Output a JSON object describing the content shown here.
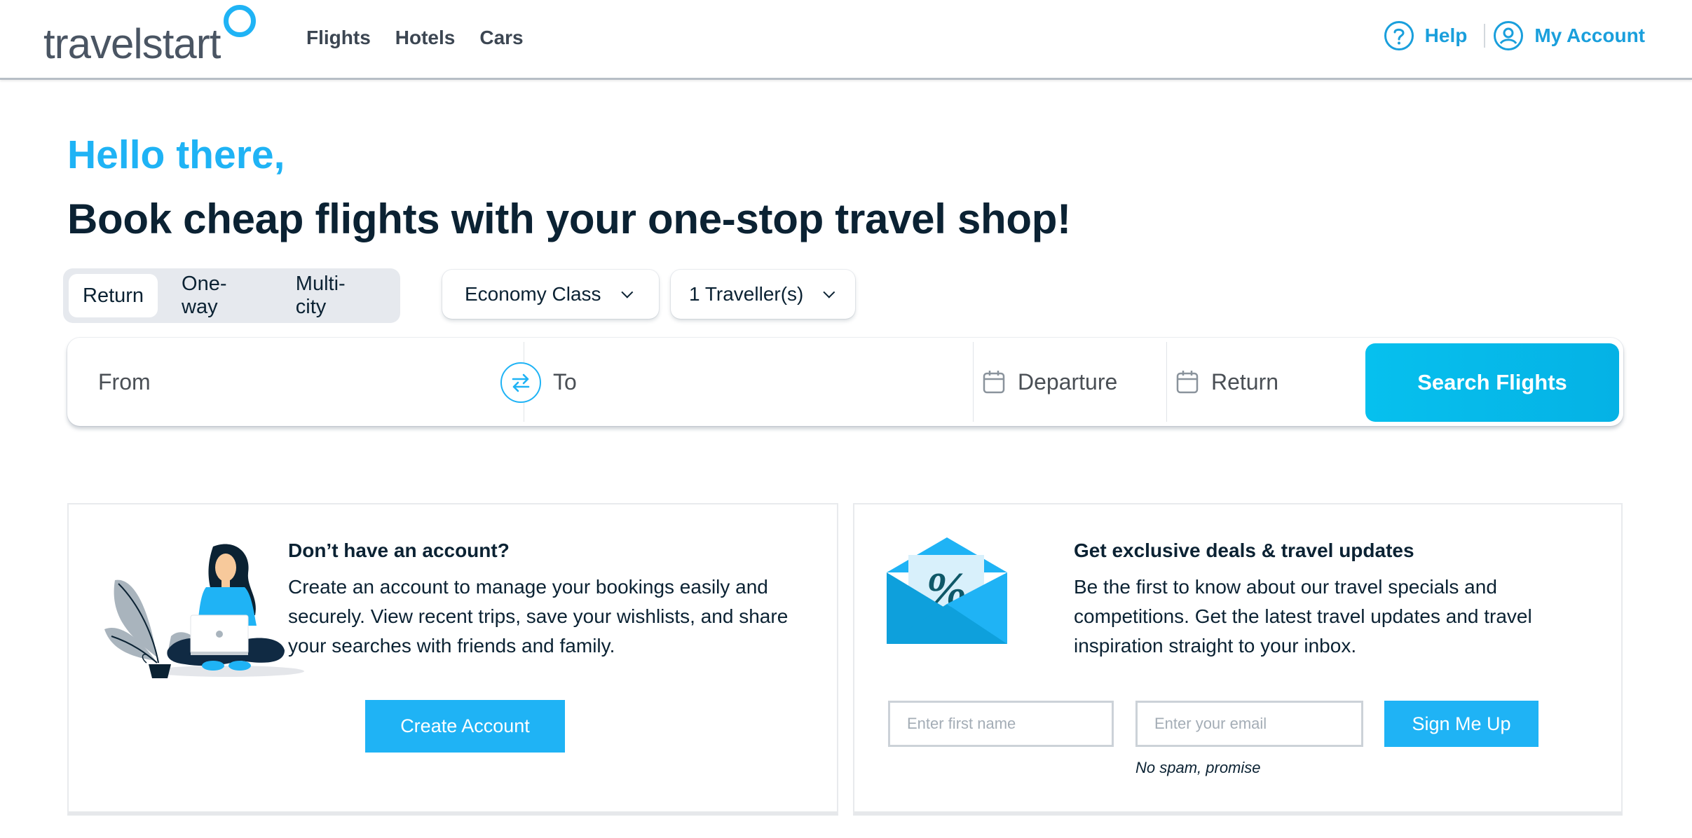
{
  "header": {
    "logo_text": "travelstart",
    "nav": [
      {
        "label": "Flights"
      },
      {
        "label": "Hotels"
      },
      {
        "label": "Cars"
      }
    ],
    "help_label": "Help",
    "account_label": "My Account",
    "accent_color": "#1a9fdc"
  },
  "hero": {
    "greeting": "Hello there,",
    "headline": "Book cheap flights with your one-stop travel shop!"
  },
  "search": {
    "trip_types": [
      {
        "label": "Return",
        "active": true
      },
      {
        "label": "One-way",
        "active": false
      },
      {
        "label": "Multi-city",
        "active": false
      }
    ],
    "cabin_class": "Economy Class",
    "travellers": "1 Traveller(s)",
    "from_placeholder": "From",
    "to_placeholder": "To",
    "departure_placeholder": "Departure",
    "return_placeholder": "Return",
    "search_button": "Search Flights",
    "button_color": "#06c0ee"
  },
  "account_card": {
    "title": "Don’t have an account?",
    "body": "Create an account to manage your bookings easily and securely. View recent trips, save your wishlists, and share your searches with friends and family.",
    "button": "Create Account"
  },
  "newsletter_card": {
    "title": "Get exclusive deals & travel updates",
    "body": "Be the first to know about our travel specials and competitions. Get the latest travel updates and travel inspiration straight to your inbox.",
    "first_name_placeholder": "Enter first name",
    "email_placeholder": "Enter your email",
    "button": "Sign Me Up",
    "note": "No spam, promise",
    "button_color": "#1fb3f5"
  }
}
